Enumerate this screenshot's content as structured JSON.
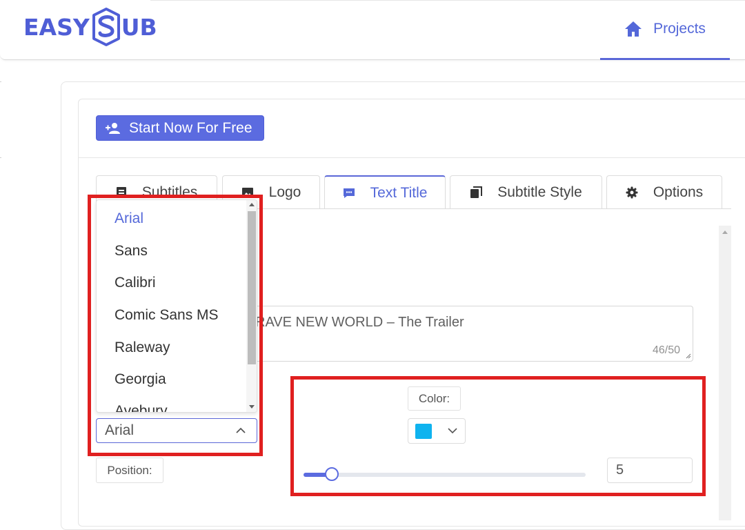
{
  "header": {
    "logo_left": "EASY",
    "logo_right": "UB",
    "nav_projects": "Projects"
  },
  "toolbar": {
    "start_label": "Start Now For Free"
  },
  "tabs": [
    {
      "label": "Subtitles",
      "icon": "subtitles-icon"
    },
    {
      "label": "Logo",
      "icon": "image-icon"
    },
    {
      "label": "Text Title",
      "icon": "chat-icon",
      "active": true
    },
    {
      "label": "Subtitle Style",
      "icon": "copy-icon"
    },
    {
      "label": "Options",
      "icon": "gear-icon"
    }
  ],
  "title_input": {
    "value": "RAVE NEW WORLD – The Trailer",
    "counter": "46/50"
  },
  "font_dropdown": {
    "options": [
      "Arial",
      "Sans",
      "Calibri",
      "Comic Sans MS",
      "Raleway",
      "Georgia",
      "Avebury"
    ],
    "selected": "Arial"
  },
  "labels": {
    "position": "Position:",
    "color": "Color:"
  },
  "color": {
    "value": "#0fb3ef"
  },
  "size": {
    "value": "5",
    "slider_fraction": 0.1
  },
  "colors": {
    "accent": "#5b6be0",
    "highlight": "#e02020"
  }
}
